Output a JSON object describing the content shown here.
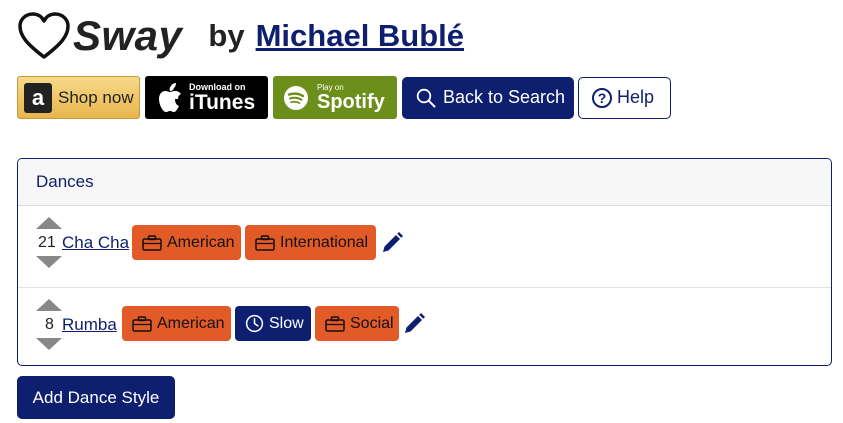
{
  "header": {
    "song_title": "Sway",
    "by_label": "by",
    "artist": "Michael Bublé"
  },
  "stores": {
    "amazon_letter": "a",
    "amazon_label": "Shop now",
    "itunes_small": "Download on",
    "itunes_big": "iTunes",
    "spotify_small": "Play on",
    "spotify_big": "Spotify"
  },
  "nav": {
    "back_label": "Back to Search",
    "help_label": "Help",
    "help_icon_char": "?"
  },
  "panel": {
    "title": "Dances",
    "dances": [
      {
        "count": "21",
        "name": "Cha Cha",
        "tags": [
          {
            "label": "American",
            "icon": "briefcase-icon",
            "color": "#e25a27"
          },
          {
            "label": "International",
            "icon": "briefcase-icon",
            "color": "#e25a27"
          }
        ]
      },
      {
        "count": "8",
        "name": "Rumba",
        "tags": [
          {
            "label": "American",
            "icon": "briefcase-icon",
            "color": "#e25a27"
          },
          {
            "label": "Slow",
            "icon": "clock-icon",
            "color": "#0d1f6e"
          },
          {
            "label": "Social",
            "icon": "briefcase-icon",
            "color": "#e25a27"
          }
        ]
      }
    ]
  },
  "actions": {
    "add_dance_label": "Add Dance Style"
  },
  "colors": {
    "navy": "#0d1f6e",
    "orange": "#e25a27",
    "spotify_green": "#6c8e1a",
    "amazon_gold": "#e8b54c"
  }
}
